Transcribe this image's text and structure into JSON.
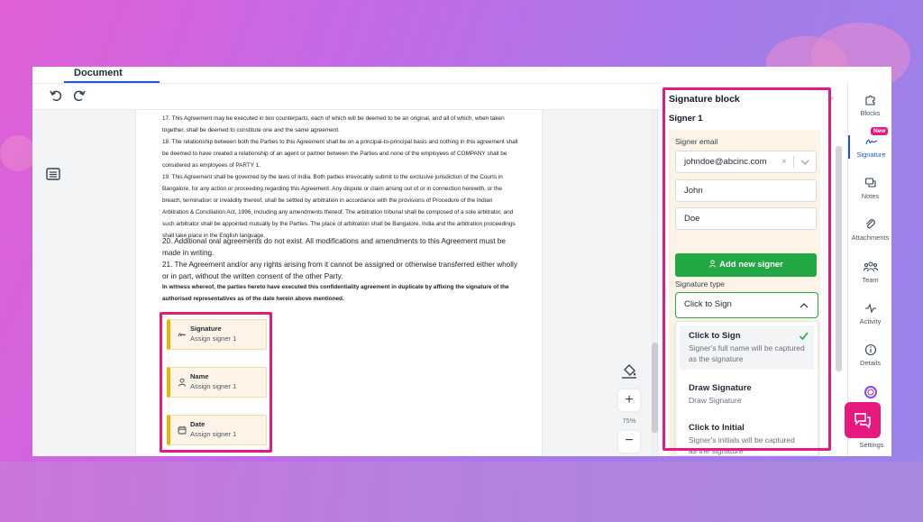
{
  "colors": {
    "accent": "#e6197e",
    "primary_blue": "#1e56d9",
    "success_green": "#22a844",
    "field_yellow": "#eab308"
  },
  "header": {
    "tab_label": "Document",
    "undo_icon": "undo-icon",
    "redo_icon": "redo-icon"
  },
  "document": {
    "paragraphs": [
      "17. This Agreement may be executed in two counterparts, each of which will be deemed to be an original, and all of which, when taken together, shall be deemed to constitute one and the same agreement.",
      "18. The relationship between both the Parties to this Agreement shall be on a principal-to-principal basis and nothing in this agreement shall be deemed to have created a relationship of an agent or partner between the Parties and none of the employees of COMPANY shall be considered as employees of PARTY 1.",
      "19. This Agreement shall be governed by the laws of India. Both parties irrevocably submit to the exclusive jurisdiction of the Courts in Bangalore, for any action or proceeding regarding this Agreement. Any dispute or claim arising out of or in connection herewith, or the breach, termination or invalidity thereof, shall be settled by arbitration in accordance with the provisions of Procedure of the Indian Arbitration & Conciliation Act, 1996, including any amendments thereof. The arbitration tribunal shall be composed of a sole arbitrator, and such arbitrator shall be appointed mutually by the Parties. The place of arbitration shall be Bangalore, India and the arbitration proceedings shall take place in the English language.",
      "20. Additional oral agreements do not exist. All modifications and amendments to this Agreement must be made in writing.",
      "21. The Agreement and/or any rights arising from it cannot be assigned or otherwise transferred either wholly or in part, without the written consent of the other Party.",
      "In witness whereof, the parties hereto have executed this confidentiality agreement in duplicate by affixing the signature of the authorised representatives as of the date herein above mentioned."
    ],
    "fields": [
      {
        "title": "Signature",
        "sub": "Assign signer 1",
        "icon": "signature-icon"
      },
      {
        "title": "Name",
        "sub": "Assign signer 1",
        "icon": "person-icon"
      },
      {
        "title": "Date",
        "sub": "Assign signer 1",
        "icon": "calendar-icon"
      }
    ]
  },
  "zoom": {
    "level": "75%",
    "plus": "+",
    "minus": "−"
  },
  "panel": {
    "title": "Signature block",
    "signer_heading": "Signer 1",
    "email_label": "Signer email",
    "email_value": "johndoe@abcinc.com",
    "email_clear": "×",
    "first_name": "John",
    "last_name": "Doe",
    "add_signer": "Add new signer",
    "type_label": "Signature type",
    "type_value": "Click to Sign",
    "close": "×",
    "options": [
      {
        "title": "Click to Sign",
        "desc": "Signer's full name will be captured as the signature"
      },
      {
        "title": "Draw Signature",
        "desc": "Draw Signature"
      },
      {
        "title": "Click to Initial",
        "desc": "Signer's initials will be captured as the signature"
      }
    ]
  },
  "rail": {
    "items": [
      {
        "label": "Blocks",
        "icon": "puzzle-icon"
      },
      {
        "label": "Signature",
        "icon": "signature-icon"
      },
      {
        "label": "Notes",
        "icon": "notes-icon"
      },
      {
        "label": "Attachments",
        "icon": "paperclip-icon"
      },
      {
        "label": "Team",
        "icon": "team-icon"
      },
      {
        "label": "Activity",
        "icon": "activity-icon"
      },
      {
        "label": "Details",
        "icon": "info-icon"
      }
    ],
    "new_badge": "New",
    "settings": "Settings"
  }
}
